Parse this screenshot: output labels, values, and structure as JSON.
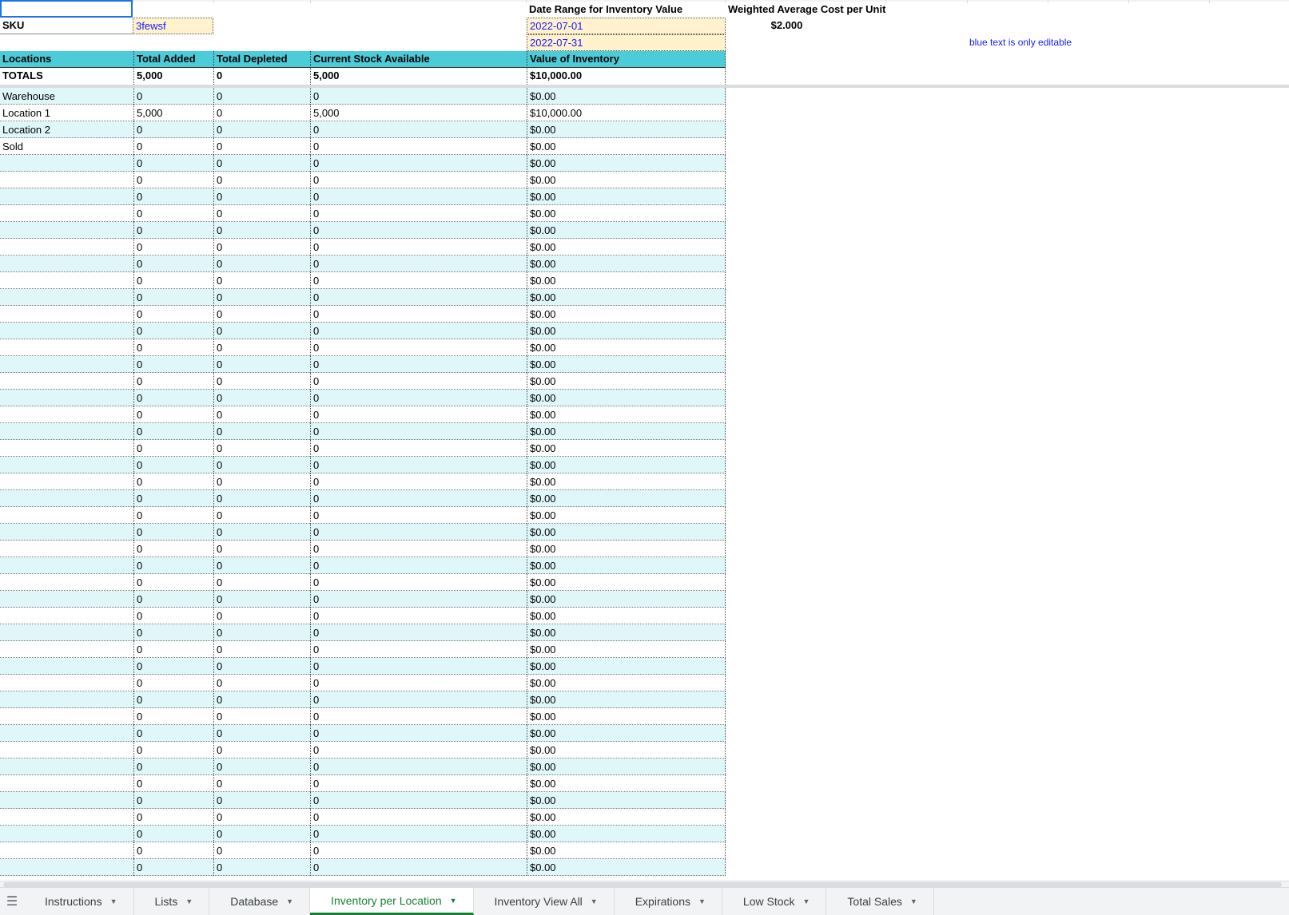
{
  "sheet": {
    "sku_label": "SKU",
    "sku_value": "3fewsf",
    "date_range_label": "Date Range for Inventory Value",
    "date_start": "2022-07-01",
    "date_end": "2022-07-31",
    "wac_label": "Weighted Average Cost per Unit",
    "wac_value": "$2.000",
    "editable_note": "blue text is only editable",
    "headers": {
      "locations": "Locations",
      "total_added": "Total Added",
      "total_depleted": "Total Depleted",
      "current_stock": "Current Stock Available",
      "inventory_value": "Value of Inventory"
    },
    "totals": {
      "label": "TOTALS",
      "total_added": "5,000",
      "total_depleted": "0",
      "current_stock": "5,000",
      "inventory_value": "$10,000.00"
    },
    "rows": [
      {
        "location": "Warehouse",
        "added": "0",
        "depleted": "0",
        "stock": "0",
        "value": "$0.00"
      },
      {
        "location": "Location 1",
        "added": "5,000",
        "depleted": "0",
        "stock": "5,000",
        "value": "$10,000.00"
      },
      {
        "location": "Location 2",
        "added": "0",
        "depleted": "0",
        "stock": "0",
        "value": "$0.00"
      },
      {
        "location": "Sold",
        "added": "0",
        "depleted": "0",
        "stock": "0",
        "value": "$0.00"
      },
      {
        "location": "",
        "added": "0",
        "depleted": "0",
        "stock": "0",
        "value": "$0.00"
      },
      {
        "location": "",
        "added": "0",
        "depleted": "0",
        "stock": "0",
        "value": "$0.00"
      },
      {
        "location": "",
        "added": "0",
        "depleted": "0",
        "stock": "0",
        "value": "$0.00"
      },
      {
        "location": "",
        "added": "0",
        "depleted": "0",
        "stock": "0",
        "value": "$0.00"
      },
      {
        "location": "",
        "added": "0",
        "depleted": "0",
        "stock": "0",
        "value": "$0.00"
      },
      {
        "location": "",
        "added": "0",
        "depleted": "0",
        "stock": "0",
        "value": "$0.00"
      },
      {
        "location": "",
        "added": "0",
        "depleted": "0",
        "stock": "0",
        "value": "$0.00"
      },
      {
        "location": "",
        "added": "0",
        "depleted": "0",
        "stock": "0",
        "value": "$0.00"
      },
      {
        "location": "",
        "added": "0",
        "depleted": "0",
        "stock": "0",
        "value": "$0.00"
      },
      {
        "location": "",
        "added": "0",
        "depleted": "0",
        "stock": "0",
        "value": "$0.00"
      },
      {
        "location": "",
        "added": "0",
        "depleted": "0",
        "stock": "0",
        "value": "$0.00"
      },
      {
        "location": "",
        "added": "0",
        "depleted": "0",
        "stock": "0",
        "value": "$0.00"
      },
      {
        "location": "",
        "added": "0",
        "depleted": "0",
        "stock": "0",
        "value": "$0.00"
      },
      {
        "location": "",
        "added": "0",
        "depleted": "0",
        "stock": "0",
        "value": "$0.00"
      },
      {
        "location": "",
        "added": "0",
        "depleted": "0",
        "stock": "0",
        "value": "$0.00"
      },
      {
        "location": "",
        "added": "0",
        "depleted": "0",
        "stock": "0",
        "value": "$0.00"
      },
      {
        "location": "",
        "added": "0",
        "depleted": "0",
        "stock": "0",
        "value": "$0.00"
      },
      {
        "location": "",
        "added": "0",
        "depleted": "0",
        "stock": "0",
        "value": "$0.00"
      },
      {
        "location": "",
        "added": "0",
        "depleted": "0",
        "stock": "0",
        "value": "$0.00"
      },
      {
        "location": "",
        "added": "0",
        "depleted": "0",
        "stock": "0",
        "value": "$0.00"
      },
      {
        "location": "",
        "added": "0",
        "depleted": "0",
        "stock": "0",
        "value": "$0.00"
      },
      {
        "location": "",
        "added": "0",
        "depleted": "0",
        "stock": "0",
        "value": "$0.00"
      },
      {
        "location": "",
        "added": "0",
        "depleted": "0",
        "stock": "0",
        "value": "$0.00"
      },
      {
        "location": "",
        "added": "0",
        "depleted": "0",
        "stock": "0",
        "value": "$0.00"
      },
      {
        "location": "",
        "added": "0",
        "depleted": "0",
        "stock": "0",
        "value": "$0.00"
      },
      {
        "location": "",
        "added": "0",
        "depleted": "0",
        "stock": "0",
        "value": "$0.00"
      },
      {
        "location": "",
        "added": "0",
        "depleted": "0",
        "stock": "0",
        "value": "$0.00"
      },
      {
        "location": "",
        "added": "0",
        "depleted": "0",
        "stock": "0",
        "value": "$0.00"
      },
      {
        "location": "",
        "added": "0",
        "depleted": "0",
        "stock": "0",
        "value": "$0.00"
      },
      {
        "location": "",
        "added": "0",
        "depleted": "0",
        "stock": "0",
        "value": "$0.00"
      },
      {
        "location": "",
        "added": "0",
        "depleted": "0",
        "stock": "0",
        "value": "$0.00"
      },
      {
        "location": "",
        "added": "0",
        "depleted": "0",
        "stock": "0",
        "value": "$0.00"
      },
      {
        "location": "",
        "added": "0",
        "depleted": "0",
        "stock": "0",
        "value": "$0.00"
      },
      {
        "location": "",
        "added": "0",
        "depleted": "0",
        "stock": "0",
        "value": "$0.00"
      },
      {
        "location": "",
        "added": "0",
        "depleted": "0",
        "stock": "0",
        "value": "$0.00"
      },
      {
        "location": "",
        "added": "0",
        "depleted": "0",
        "stock": "0",
        "value": "$0.00"
      },
      {
        "location": "",
        "added": "0",
        "depleted": "0",
        "stock": "0",
        "value": "$0.00"
      },
      {
        "location": "",
        "added": "0",
        "depleted": "0",
        "stock": "0",
        "value": "$0.00"
      },
      {
        "location": "",
        "added": "0",
        "depleted": "0",
        "stock": "0",
        "value": "$0.00"
      },
      {
        "location": "",
        "added": "0",
        "depleted": "0",
        "stock": "0",
        "value": "$0.00"
      },
      {
        "location": "",
        "added": "0",
        "depleted": "0",
        "stock": "0",
        "value": "$0.00"
      },
      {
        "location": "",
        "added": "0",
        "depleted": "0",
        "stock": "0",
        "value": "$0.00"
      },
      {
        "location": "",
        "added": "0",
        "depleted": "0",
        "stock": "0",
        "value": "$0.00"
      }
    ]
  },
  "tabs": [
    {
      "label": "Instructions",
      "active": false
    },
    {
      "label": "Lists",
      "active": false
    },
    {
      "label": "Database",
      "active": false
    },
    {
      "label": "Inventory per Location",
      "active": true
    },
    {
      "label": "Inventory View All",
      "active": false
    },
    {
      "label": "Expirations",
      "active": false
    },
    {
      "label": "Low Stock",
      "active": false
    },
    {
      "label": "Total Sales",
      "active": false
    }
  ],
  "icons": {
    "all_sheets": "menu-icon",
    "tab_menu": "caret-down-icon"
  },
  "colors": {
    "header_bg": "#4ccbd9",
    "alt_row_bg": "#e0f7fa",
    "input_bg": "#fff2cc",
    "editable_text": "#1a1aff",
    "active_tab": "#188038",
    "selection": "#1a73e8"
  }
}
